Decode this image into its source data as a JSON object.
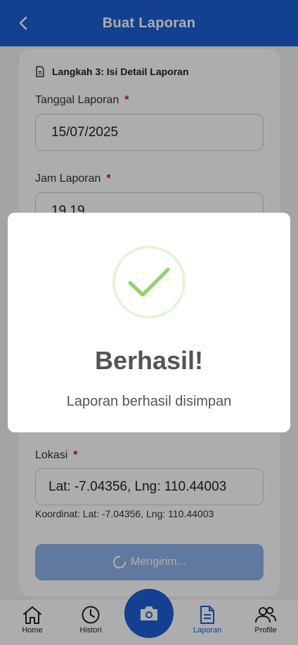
{
  "header": {
    "title": "Buat Laporan"
  },
  "form": {
    "step_title": "Langkah 3: Isi Detail Laporan",
    "tanggal_label": "Tanggal Laporan",
    "tanggal_value": "15/07/2025",
    "jam_label": "Jam Laporan",
    "jam_value": "19.19",
    "lokasi_label": "Lokasi",
    "lokasi_value": "Lat: -7.04356, Lng: 110.44003",
    "koordinat_text": "Koordinat: Lat: -7.04356, Lng: 110.44003",
    "required_mark": "*",
    "submit_label": "Mengirim..."
  },
  "dialog": {
    "title": "Berhasil!",
    "message": "Laporan berhasil disimpan"
  },
  "nav": {
    "items": [
      {
        "label": "Home",
        "icon": "home-icon"
      },
      {
        "label": "Histori",
        "icon": "clock-icon"
      },
      {
        "label": "Laporan",
        "icon": "document-icon",
        "active": true
      },
      {
        "label": "Profile",
        "icon": "users-icon"
      }
    ],
    "fab_icon": "camera-icon"
  },
  "colors": {
    "primary": "#1c5fd4",
    "success": "#8bd46c",
    "required": "#cc1010",
    "submit_disabled": "#8fb2ea"
  }
}
